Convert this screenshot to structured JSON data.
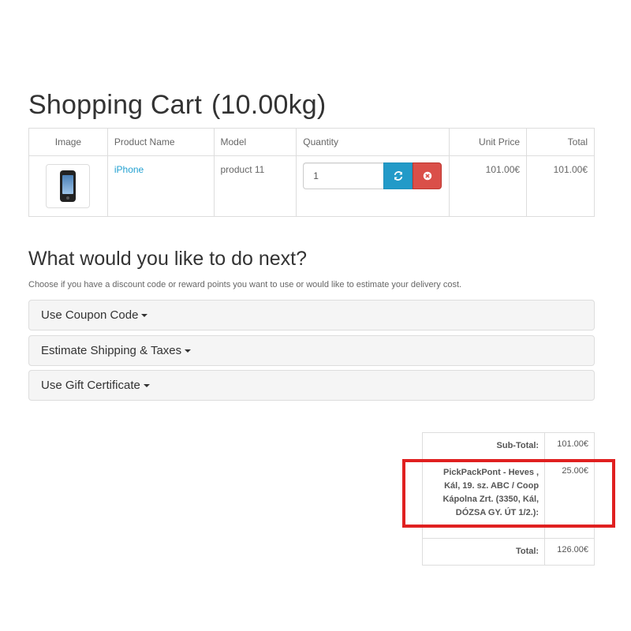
{
  "page": {
    "title": "Shopping Cart",
    "weight": "(10.00kg)"
  },
  "cart": {
    "headers": {
      "image": "Image",
      "product_name": "Product Name",
      "model": "Model",
      "quantity": "Quantity",
      "unit_price": "Unit Price",
      "total": "Total"
    },
    "rows": [
      {
        "image_icon": "iphone-thumbnail",
        "product_name": "iPhone",
        "model": "product 11",
        "quantity": "1",
        "unit_price": "101.00€",
        "total": "101.00€"
      }
    ],
    "update_icon": "refresh-icon",
    "remove_icon": "remove-circle-icon"
  },
  "next": {
    "title": "What would you like to do next?",
    "description": "Choose if you have a discount code or reward points you want to use or would like to estimate your delivery cost.",
    "panels": [
      {
        "label": "Use Coupon Code"
      },
      {
        "label": "Estimate Shipping & Taxes"
      },
      {
        "label": "Use Gift Certificate"
      }
    ]
  },
  "totals": {
    "sub_total_label": "Sub-Total:",
    "sub_total_value": "101.00€",
    "shipping_label": "PickPackPont - Heves , Kál, 19. sz. ABC / Coop Kápolna Zrt. (3350, Kál, DÓZSA GY. ÚT 1/2.):",
    "shipping_value": "25.00€",
    "total_label": "Total:",
    "total_value": "126.00€"
  },
  "colors": {
    "link": "#23a1d1",
    "update_button": "#229ac8",
    "remove_button": "#da4f49",
    "highlight": "#e02020"
  }
}
